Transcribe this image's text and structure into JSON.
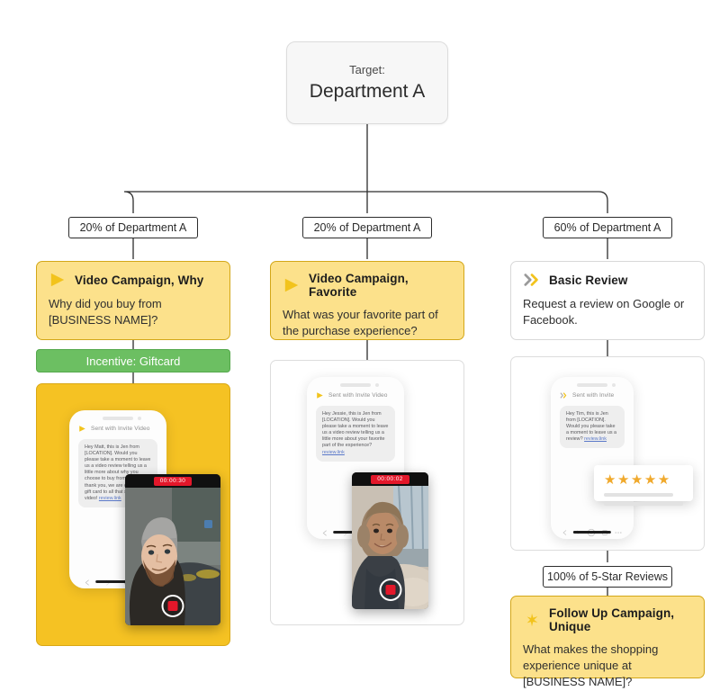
{
  "target": {
    "label": "Target:",
    "name": "Department A"
  },
  "branch_labels": {
    "left": "20% of Department A",
    "middle": "20% of Department A",
    "right": "60% of Department A",
    "followup": "100% of 5-Star Reviews"
  },
  "cards": [
    {
      "id": "video-why",
      "icon": "play-triangle-icon",
      "title": "Video Campaign, Why",
      "body": "Why did you buy from [BUSINESS NAME]?",
      "style": "yellow"
    },
    {
      "id": "video-favorite",
      "icon": "play-triangle-icon",
      "title": "Video Campaign, Favorite",
      "body": "What was your favorite part of the purchase experience?",
      "style": "yellow"
    },
    {
      "id": "basic-review",
      "icon": "double-chevron-icon",
      "title": "Basic Review",
      "body": "Request a review on Google or Facebook.",
      "style": "white"
    },
    {
      "id": "follow-up-unique",
      "icon": "spark-icon",
      "title": "Follow Up Campaign, Unique",
      "body": "What makes the shopping experience unique at [BUSINESS NAME]?",
      "style": "yellow"
    }
  ],
  "incentive": {
    "label": "Incentive: Giftcard"
  },
  "previews": [
    {
      "id": "preview-why",
      "sent_label": "Sent with Invite Video",
      "message": "Hey Matt, this is Jen from [LOCATION]. Would you please take a moment to leave us a video review telling us a little more about why you choose to buy from us? As a thank you, we are offering a gift card to all that submit a video!",
      "link_text": "review.link",
      "timer": "00:00:30"
    },
    {
      "id": "preview-favorite",
      "sent_label": "Sent with Invite Video",
      "message": "Hey Jessie, this is Jen from [LOCATION]. Would you please take a moment to leave us a video review telling us a little more about your favorite part of the experience?",
      "link_text": "review.link",
      "timer": "00:00:02"
    },
    {
      "id": "preview-review",
      "sent_label": "Sent with Invite",
      "message": "Hey Tim, this is Jen from [LOCATION]. Would you please take a moment to leave us a review?",
      "link_text": "review.link",
      "stars": "★★★★★"
    }
  ],
  "colors": {
    "card_yellow": "#fce18b",
    "card_yellow_border": "#d3a718",
    "panel_gold": "#f5c223",
    "incentive_green": "#6cbf62",
    "record_red": "#e3172a",
    "star_gold": "#f0a92c",
    "accent_yellow": "#f2c31c"
  }
}
